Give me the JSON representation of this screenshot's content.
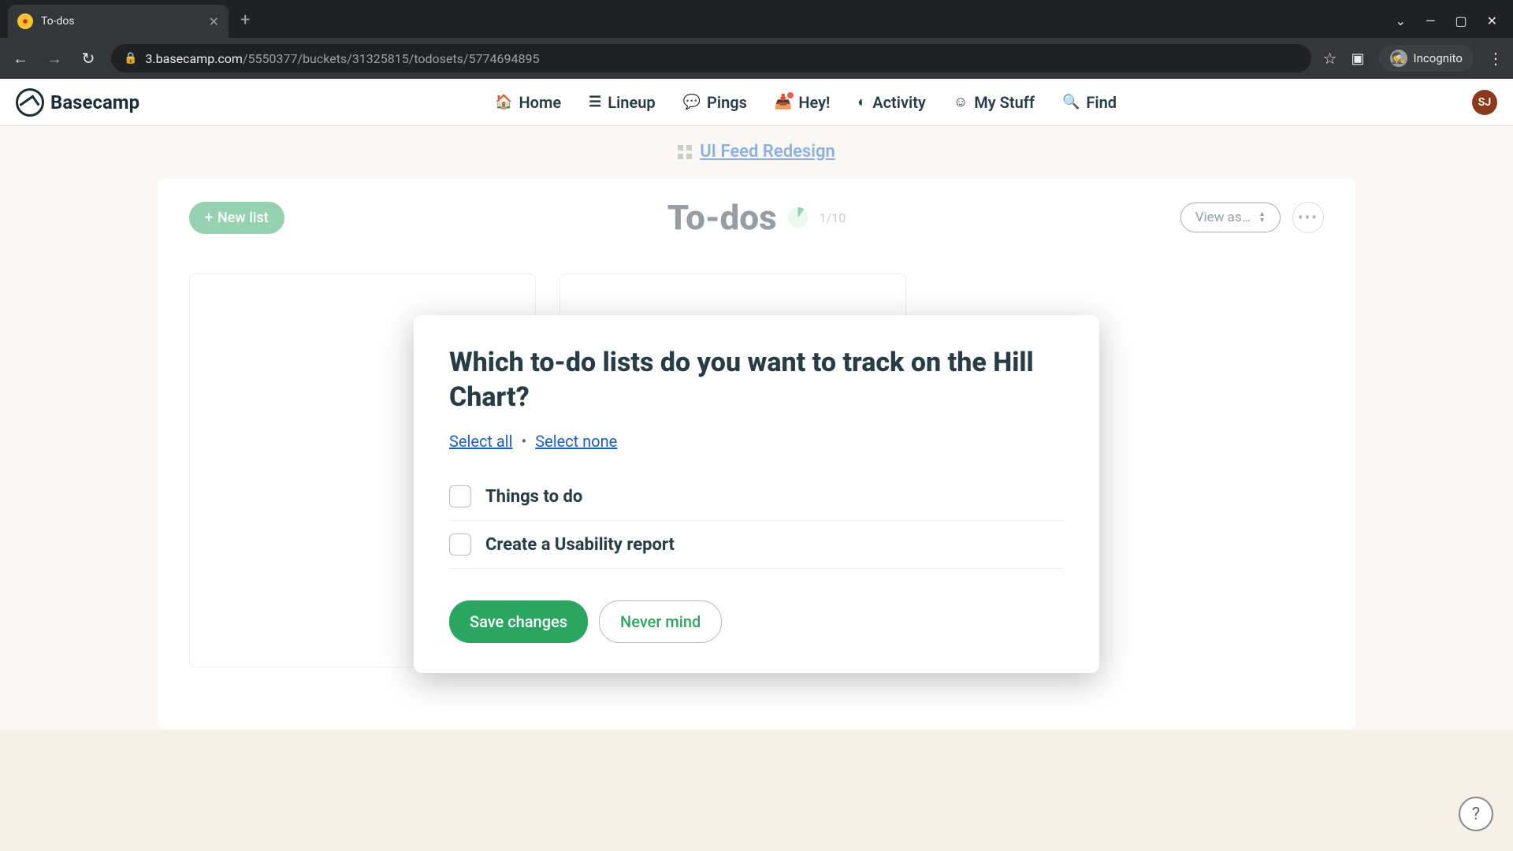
{
  "browser": {
    "tab_title": "To-dos",
    "url_host": "3.basecamp.com",
    "url_path": "/5550377/buckets/31325815/todosets/5774694895",
    "incognito_label": "Incognito"
  },
  "nav": {
    "logo": "Basecamp",
    "items": [
      {
        "icon": "🏠",
        "label": "Home"
      },
      {
        "icon": "≡",
        "label": "Lineup"
      },
      {
        "icon": "💬",
        "label": "Pings"
      },
      {
        "icon": "📥",
        "label": "Hey!"
      },
      {
        "icon": "◐",
        "label": "Activity"
      },
      {
        "icon": "☺",
        "label": "My Stuff"
      },
      {
        "icon": "🔍",
        "label": "Find"
      }
    ],
    "avatar": "SJ"
  },
  "breadcrumb": {
    "project": "UI Feed Redesign"
  },
  "page": {
    "new_list_label": "New list",
    "title": "To-dos",
    "count": "1/10",
    "view_as_label": "View as…"
  },
  "modal": {
    "title": "Which to-do lists do you want to track on the Hill Chart?",
    "select_all": "Select all",
    "select_none": "Select none",
    "lists": [
      {
        "name": "Things to do",
        "checked": false
      },
      {
        "name": "Create a Usability report",
        "checked": false
      }
    ],
    "save_label": "Save changes",
    "cancel_label": "Never mind"
  },
  "help": "?"
}
